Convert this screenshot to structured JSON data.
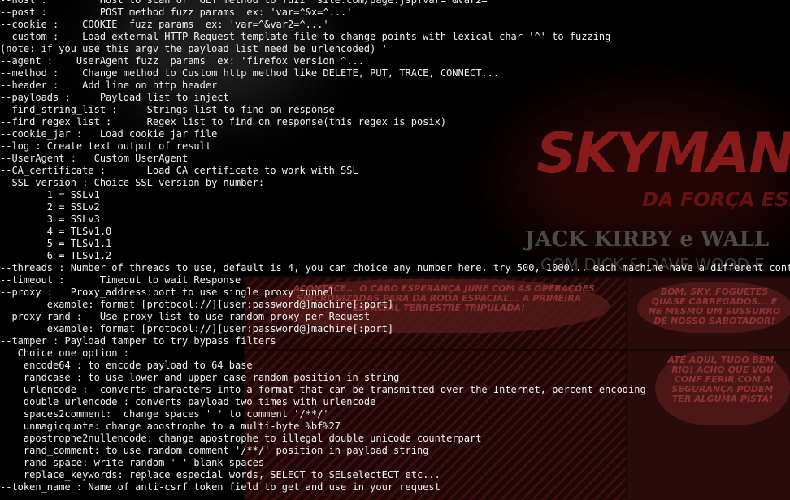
{
  "terminal": {
    "lines": [
      "--host :         Host to scan or  GET method to fuzz  site.com/page.jsp?var=^&var2=^",
      "--post :         POST method fuzz params  ex: 'var=^&x=^...'",
      "--cookie :    COOKIE  fuzz params  ex: 'var=^&var2=^...'",
      "--custom :    Load external HTTP Request template file to change points with lexical char '^' to fuzzing",
      "(note: if you use this argv the payload list need be urlencoded) '",
      "--agent :    UserAgent fuzz  params  ex: 'firefox version ^...'",
      "--method :    Change method to Custom http method like DELETE, PUT, TRACE, CONNECT...",
      "--header :    Add line on http header",
      "--payloads :     Payload list to inject",
      "--find_string_list :     Strings list to find on response",
      "--find_regex_list :      Regex list to find on response(this regex is posix)",
      "--cookie_jar :   Load cookie jar file",
      "--log : Create text output of result",
      "--UserAgent :   Custom UserAgent",
      "--CA_certificate :       Load CA certificate to work with SSL",
      "--SSL_version : Choice SSL version by number:",
      "        1 = SSLv1",
      "        2 = SSLv2",
      "        3 = SSLv3",
      "        4 = TLSv1.0",
      "        5 = TLSv1.1",
      "        6 = TLSv1.2",
      "--threads : Number of threads to use, default is 4, you can choice any number here, try 500, 1000... each machine have a different context.",
      "--timeout :      Timeout to wait Response",
      "--proxy :   Proxy_address:port to use single proxy tunnel",
      "        example: format [protocol://][user:password@]machine[:port]",
      "--proxy-rand :   Use proxy list to use random proxy per Request",
      "        example: format [protocol://][user:password@]machine[:port]",
      "--tamper : Payload tamper to try bypass filters",
      "   Choice one option :",
      "    encode64 : to encode payload to 64 base",
      "    randcase : to use lower and upper case random position in string",
      "    urlencode :  converts characters into a format that can be transmitted over the Internet, percent encoding",
      "    double_urlencode : converts payload two times with urlencode",
      "    spaces2comment:  change spaces ' ' to comment '/**/'",
      "    unmagicquote: change apostrophe to a multi-byte %bf%27",
      "    apostrophe2nullencode: change apostrophe to illegal double unicode counterpart",
      "    rand_comment: to use random comment '/**/' position in payload string",
      "    rand_space: write random ' ' blank spaces",
      "    replace_keywords: replace especial words, SELECT to SELselectECT etc...",
      "--token_name : Name of anti-csrf token field to get and use in your request"
    ]
  },
  "wallpaper": {
    "logo": "SKYMAN",
    "tagline": "DA FORÇA ESP",
    "credit_names": "JACK KIRBY e WALL",
    "credit_sub": "COM DICK & DAVE WOOD E",
    "bubbles": [
      "...ACONTECE... O CABO ESPERANÇA JUNE COM AS OPERAÇÕES SINCRONIZADAS PARA DA RODA ESPACIAL... A PRIMEIRA ESPACIAL TERRESTRE TRIPULADA!",
      "BOM, SKY, FOGUETES QUASE CARREGADOS... E NE MESMO UM SUSSURRO DE NOSSO SABOTADOR!",
      "ATÉ AQUI, TUDO BEM, RIO! ACHO QUE VOU CONF FERIR COM A SEGURANÇA PODEM TER ALGUMA PISTA!"
    ],
    "colors": {
      "background": "#000000",
      "accent_red": "#9a1e1e",
      "terminal_text": "#f2f2f2"
    }
  }
}
